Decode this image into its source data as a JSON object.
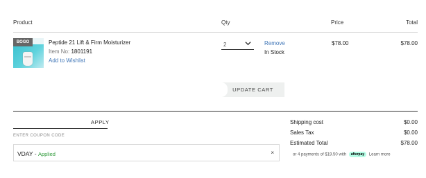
{
  "columns": {
    "product": "Product",
    "qty": "Qty",
    "price": "Price",
    "total": "Total"
  },
  "item": {
    "badge": "BOGO",
    "name": "Peptide 21 Lift & Firm Moisturizer",
    "item_no_label": "Item No:",
    "item_no": "1801191",
    "wishlist": "Add to Wishlist",
    "qty": "2",
    "remove": "Remove",
    "stock": "In Stock",
    "price": "$78.00",
    "total": "$78.00"
  },
  "cart": {
    "update_label": "UPDATE CART"
  },
  "coupon": {
    "apply_tab": "APPLY",
    "field_label": "ENTER COUPON CODE",
    "code": "VDAY",
    "separator": " - ",
    "status": "Applied",
    "close": "×"
  },
  "summary": {
    "rows": [
      {
        "label": "Shipping cost",
        "value": "$0.00"
      },
      {
        "label": "Sales Tax",
        "value": "$0.00"
      },
      {
        "label": "Estimated Total",
        "value": "$78.00"
      }
    ],
    "afterpay": {
      "text": "or 4 payments of $19.50 with",
      "logo": "afterpay",
      "learn_more": "Learn more"
    }
  },
  "colors": {
    "link": "#3d74b6",
    "applied": "#2f9a3a",
    "afterpay_mint": "#b2fce4"
  }
}
